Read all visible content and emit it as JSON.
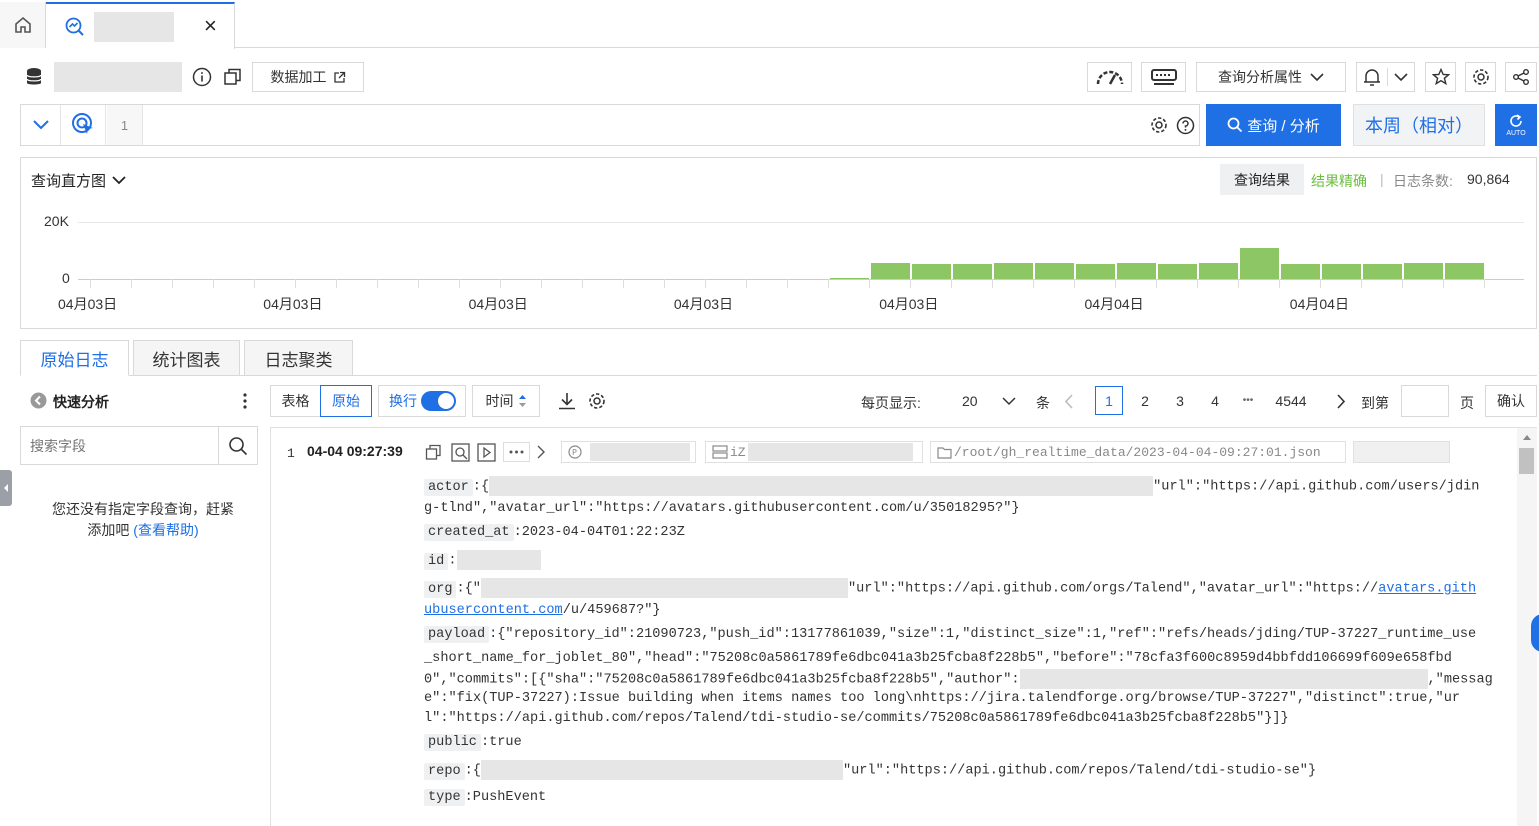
{
  "tabs": {
    "close": "×"
  },
  "header": {
    "data_process": "数据加工",
    "query_props": "查询分析属性"
  },
  "query": {
    "line_no": "1",
    "search_btn": "查询 / 分析",
    "time_range": "本周（相对）",
    "auto": "AUTO"
  },
  "histogram": {
    "title": "查询直方图",
    "result_label": "查询结果",
    "precise": "结果精确",
    "sep": "|",
    "count_label": "日志条数:",
    "count": "90,864",
    "ytick_top": "20K",
    "ytick_zero": "0",
    "xticks": [
      "04月03日",
      "04月03日",
      "04月03日",
      "04月03日",
      "04月03日",
      "04月04日",
      "04月04日"
    ]
  },
  "chart_data": {
    "type": "bar",
    "title": "查询直方图",
    "ylim": [
      0,
      20000
    ],
    "yticks": [
      "20K",
      "0"
    ],
    "xticks": [
      "04月03日",
      "04月03日",
      "04月03日",
      "04月03日",
      "04月03日",
      "04月04日",
      "04月04日"
    ],
    "values": [
      400,
      5500,
      5200,
      5200,
      5600,
      5600,
      5300,
      5600,
      5400,
      5600,
      11000,
      5400,
      5400,
      5400,
      5600,
      5600
    ]
  },
  "view_tabs": [
    "原始日志",
    "统计图表",
    "日志聚类"
  ],
  "sidebar": {
    "title": "快速分析",
    "search_placeholder": "搜索字段",
    "empty_msg_1": "您还没有指定字段查询，赶紧",
    "empty_msg_2": "添加吧",
    "help_link": "(查看帮助)"
  },
  "toolbar": {
    "table": "表格",
    "raw": "原始",
    "wrap": "换行",
    "time": "时间",
    "per_page_label": "每页显示:",
    "per_page": "20",
    "unit": "条",
    "pages": [
      "1",
      "2",
      "3",
      "4"
    ],
    "ellipsis": "•••",
    "last_page": "4544",
    "goto": "到第",
    "page_unit": "页",
    "confirm": "确认"
  },
  "log": {
    "index": "1",
    "time": "04-04 09:27:39",
    "source_partial": "iZ",
    "file_path": "/root/gh_realtime_data/2023-04-04-09:27:01.json",
    "fields": {
      "actor_key": "actor",
      "actor_open": ":{",
      "actor_url": "\"url\":\"https://api.github.com/users/jdin",
      "actor_line2": "g-tlnd\",\"avatar_url\":\"https://avatars.githubusercontent.com/u/35018295?\"}",
      "created_key": "created_at",
      "created_val": ":2023-04-04T01:22:23Z",
      "id_key": "id",
      "id_val": ":",
      "org_key": "org",
      "org_open": ":{\"",
      "org_url": "\"url\":\"https://api.github.com/orgs/Talend\",\"avatar_url\":\"https://",
      "org_link1": "avatars.gith",
      "org_link2": "ubusercontent.com",
      "org_tail": "/u/459687?\"}",
      "payload_key": "payload",
      "payload_1": ":{\"repository_id\":21090723,\"push_id\":13177861039,\"size\":1,\"distinct_size\":1,\"ref\":\"refs/heads/jding/TUP-37227_runtime_use",
      "payload_2": "_short_name_for_joblet_80\",\"head\":\"75208c0a5861789fe6dbc041a3b25fcba8f228b5\",\"before\":\"78cfa3f600c8959d4bbfdd106699f609e658fbd",
      "payload_3a": "0\",\"commits\":[{\"sha\":\"75208c0a5861789fe6dbc041a3b25fcba8f228b5\",\"author\":",
      "payload_3b": ",\"messag",
      "payload_4": "e\":\"fix(TUP-37227):Issue building when items names too long\\nhttps://jira.talendforge.org/browse/TUP-37227\",\"distinct\":true,\"ur",
      "payload_5": "l\":\"https://api.github.com/repos/Talend/tdi-studio-se/commits/75208c0a5861789fe6dbc041a3b25fcba8f228b5\"}]}",
      "public_key": "public",
      "public_val": ":true",
      "repo_key": "repo",
      "repo_open": ":{",
      "repo_url": "\"url\":\"https://api.github.com/repos/Talend/tdi-studio-se\"}",
      "type_key": "type",
      "type_val": ":PushEvent"
    }
  }
}
